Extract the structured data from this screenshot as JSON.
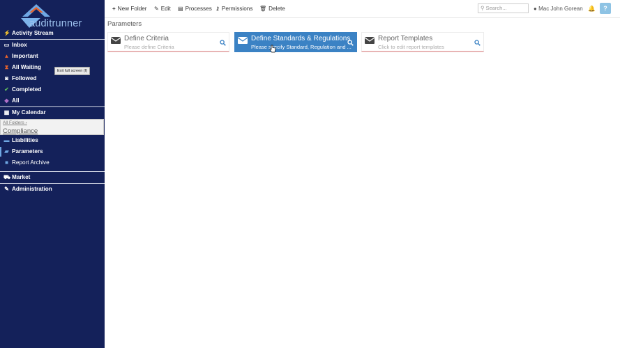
{
  "sidebar": {
    "logo_text": "auditrunner",
    "items": [
      {
        "label": "Activity Stream",
        "icon": "bolt-icon",
        "glyph": "⚡"
      },
      {
        "label": "Inbox",
        "icon": "inbox-icon",
        "glyph": "▭"
      },
      {
        "label": "Important",
        "icon": "warning-icon",
        "glyph": "▲"
      },
      {
        "label": "All Waiting",
        "icon": "hourglass-icon",
        "glyph": "⧗"
      },
      {
        "label": "Followed",
        "icon": "binoculars-icon",
        "glyph": "◙"
      },
      {
        "label": "Completed",
        "icon": "check-icon",
        "glyph": "✔"
      },
      {
        "label": "All",
        "icon": "tag-icon",
        "glyph": "◆"
      },
      {
        "label": "My Calendar",
        "icon": "calendar-icon",
        "glyph": "▦"
      },
      {
        "label": "Liabilities",
        "icon": "folder-icon",
        "glyph": "▬"
      },
      {
        "label": "Parameters",
        "icon": "folder-open-icon",
        "glyph": "▰"
      },
      {
        "label": "Report Archive",
        "icon": "archive-icon",
        "glyph": "■"
      },
      {
        "label": "Market",
        "icon": "cart-icon",
        "glyph": "⛟"
      },
      {
        "label": "Administration",
        "icon": "wrench-icon",
        "glyph": "✎"
      }
    ],
    "breadcrumb_root": "All Folders",
    "breadcrumb_sep": "›",
    "current_folder": "Compliance"
  },
  "tooltip": "Exit full screen (f)",
  "toolbar": {
    "new_folder": "New Folder",
    "edit": "Edit",
    "processes": "Processes",
    "permissions": "Permissions",
    "delete": "Delete",
    "search_placeholder": "Search...",
    "user_name": "Mac John Gorean",
    "help": "?"
  },
  "page_title": "Parameters",
  "cards": [
    {
      "title": "Define Criteria",
      "subtitle": "Please define Criteria",
      "active": false
    },
    {
      "title": "Define Standards & Regulations",
      "subtitle": "Please specify Standard, Regulation and ...",
      "active": true
    },
    {
      "title": "Report Templates",
      "subtitle": "Click to edit report templates",
      "active": false
    }
  ],
  "colors": {
    "sidebar_bg": "#14215a",
    "accent": "#3b82c4",
    "logo_orange": "#e8632b",
    "logo_blue": "#6fa8e4"
  }
}
